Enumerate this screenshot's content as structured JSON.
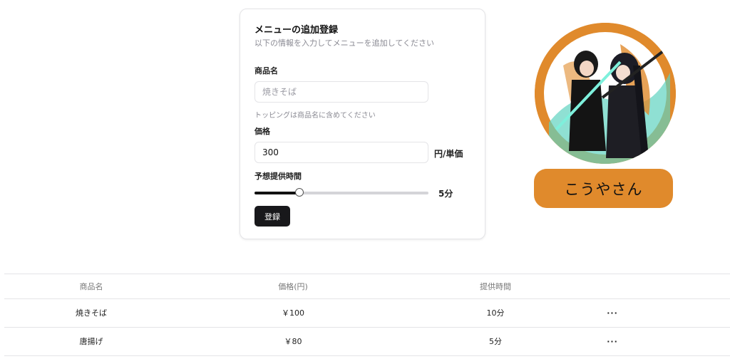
{
  "form": {
    "title": "メニューの追加登録",
    "description": "以下の情報を入力してメニューを追加してください",
    "name_label": "商品名",
    "name_placeholder": "焼きそば",
    "name_value": "",
    "name_hint": "トッピングは商品名に含めてください",
    "price_label": "価格",
    "price_value": "300",
    "price_unit": "円/単価",
    "time_label": "予想提供時間",
    "time_value_text": "5分",
    "time_fraction": 0.26,
    "submit_label": "登録"
  },
  "profile": {
    "name": "こうやさん",
    "accent_color": "#e08a2c"
  },
  "table": {
    "headers": [
      "商品名",
      "価格(円)",
      "提供時間",
      ""
    ],
    "rows": [
      {
        "name": "焼きそば",
        "price": "￥100",
        "time": "10分",
        "actions": "···"
      },
      {
        "name": "唐揚げ",
        "price": "￥80",
        "time": "5分",
        "actions": "···"
      }
    ]
  }
}
